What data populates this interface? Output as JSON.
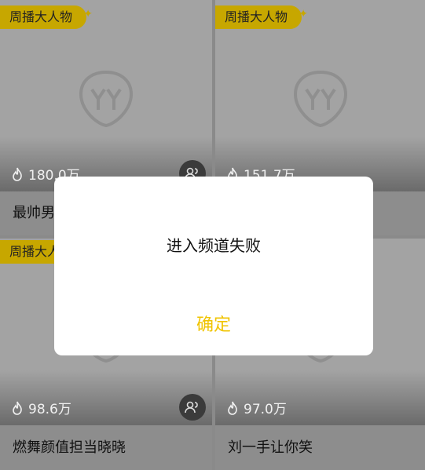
{
  "cards": [
    {
      "badge": "周播大人物",
      "views": "180.0万",
      "title": "最帅男"
    },
    {
      "badge": "周播大人物",
      "views": "151.7万",
      "title": ""
    },
    {
      "badge": "周播大人物",
      "views": "98.6万",
      "title": "燃舞颜值担当晓晓"
    },
    {
      "badge": "",
      "views": "97.0万",
      "title": "刘一手让你笑"
    }
  ],
  "dialog": {
    "message": "进入频道失败",
    "confirm_label": "确定"
  },
  "colors": {
    "accent": "#f0c400",
    "badge_bg": "#c7a700"
  },
  "icons": {
    "badge_sparkle": "sparkle-icon",
    "views": "flame-icon",
    "card_action": "people-icon"
  }
}
